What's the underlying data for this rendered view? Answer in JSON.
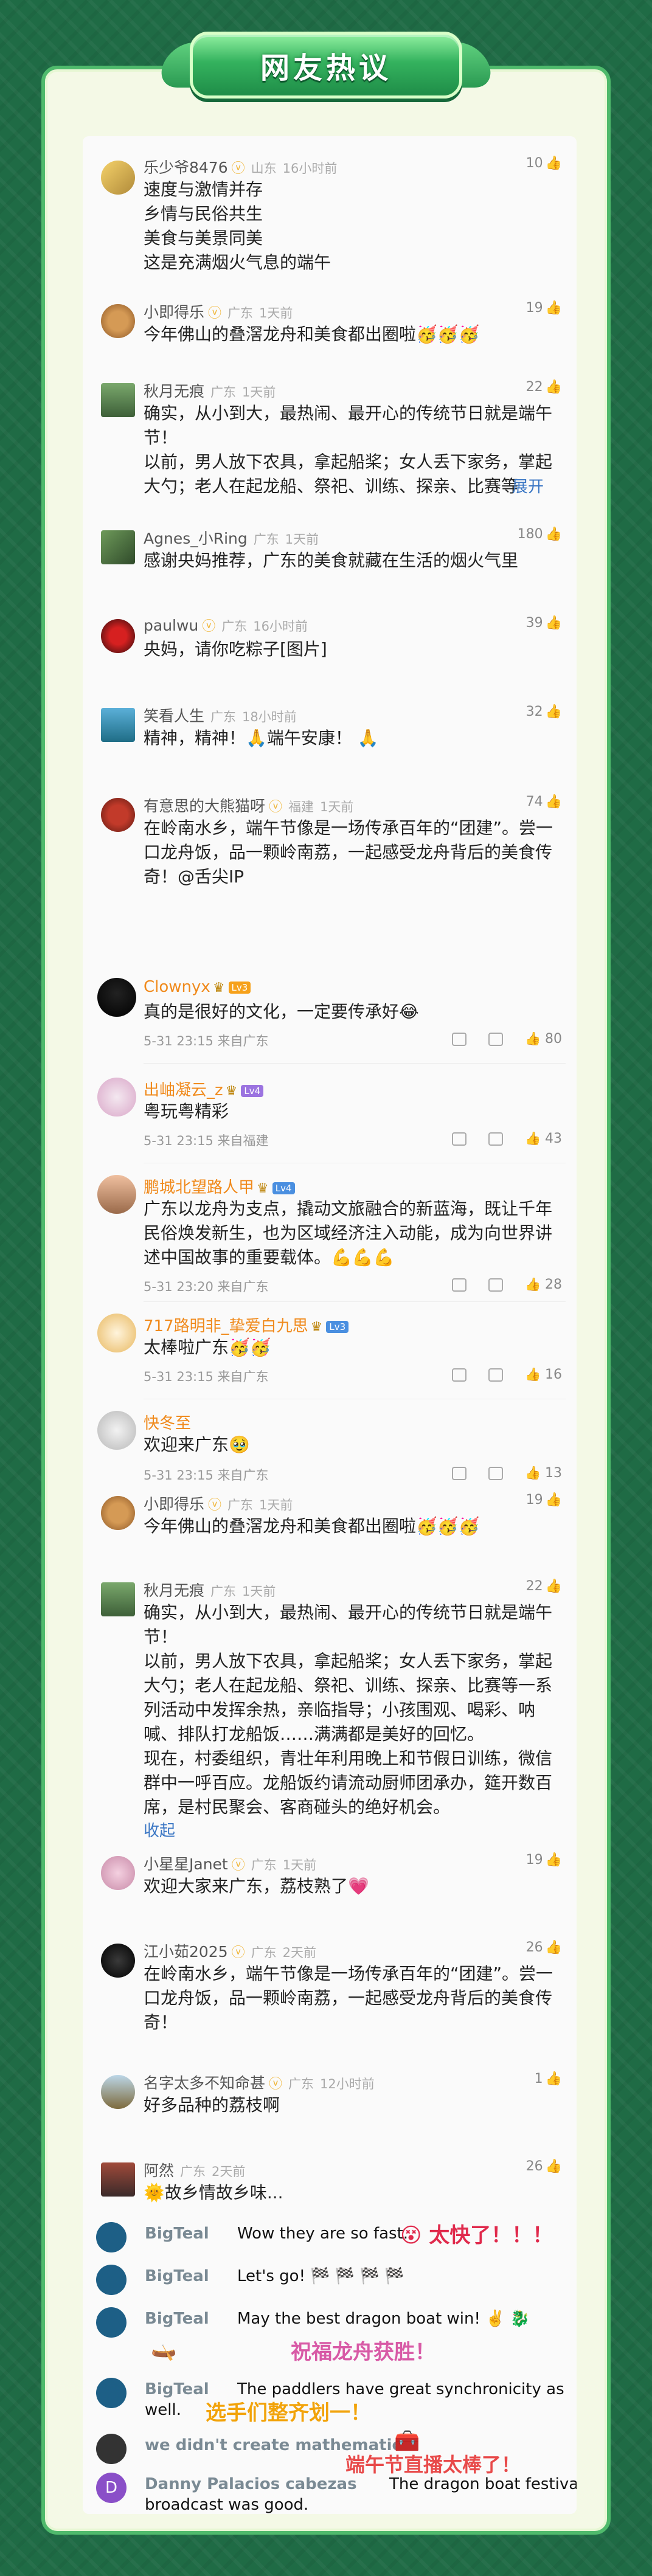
{
  "banner": {
    "title": "网友热议"
  },
  "icons": {
    "like": "thumbs-up-icon",
    "share": "share-icon",
    "reply": "comment-icon",
    "verified": "v-badge-icon"
  },
  "comments": [
    {
      "user": "乐少爷8476",
      "location": "山东",
      "time": "16小时前",
      "likes": "10",
      "lines": [
        "速度与激情并存",
        "乡情与民俗共生",
        "美食与美景同美",
        "这是充满烟火气息的端午"
      ]
    },
    {
      "user": "小即得乐",
      "location": "广东",
      "time": "1天前",
      "likes": "19",
      "lines": [
        "今年佛山的叠滘龙舟和美食都出圈啦🥳🥳🥳"
      ]
    },
    {
      "user": "秋月无痕",
      "location": "广东",
      "time": "1天前",
      "likes": "22",
      "lines": [
        "确实，从小到大，最热闹、最开心的传统节日就是端午",
        "节！",
        "以前，男人放下农具，拿起船桨；女人丢下家务，掌起",
        "大勺；老人在起龙船、祭祀、训练、探亲、比赛等"
      ],
      "expand": "展开"
    },
    {
      "user": "Agnes_小Ring",
      "location": "广东",
      "time": "1天前",
      "likes": "180",
      "lines": [
        "感谢央妈推荐，广东的美食就藏在生活的烟火气里"
      ]
    },
    {
      "user": "paulwu",
      "location": "广东",
      "time": "16小时前",
      "likes": "39",
      "lines": [
        "央妈，请你吃粽子[图片]"
      ]
    },
    {
      "user": "笑看人生",
      "location": "广东",
      "time": "18小时前",
      "likes": "32",
      "lines": [
        "精神，精神！🙏端午安康！ 🙏"
      ]
    },
    {
      "user": "有意思的大熊猫呀",
      "location": "福建",
      "time": "1天前",
      "likes": "74",
      "lines": [
        "在岭南水乡，端午节像是一场传承百年的“团建”。尝一",
        "口龙舟饭，品一颗岭南荔，一起感受龙舟背后的美食传",
        "奇！@舌尖IP"
      ]
    }
  ],
  "weibo": [
    {
      "user": "Clownyx",
      "level": "3",
      "text": "真的是很好的文化，一定要传承好😂",
      "date": "5-31 23:15 来自广东",
      "likes": "80"
    },
    {
      "user": "出岫凝云_z",
      "level": "4",
      "text": "粤玩粤精彩",
      "date": "5-31 23:15 来自福建",
      "likes": "43"
    },
    {
      "user": "鹏城北望路人甲",
      "level": "4",
      "lines": [
        "广东以龙舟为支点，撬动文旅融合的新蓝海，既让千年",
        "民俗焕发新生，也为区域经济注入动能，成为向世界讲",
        "述中国故事的重要载体。💪💪💪"
      ],
      "date": "5-31 23:20 来自广东",
      "likes": "28"
    },
    {
      "user": "717路明非_挚爱白九思",
      "level": "3",
      "text": "太棒啦广东🥳🥳",
      "date": "5-31 23:15 来自广东",
      "likes": "16"
    },
    {
      "user": "快冬至",
      "text": "欢迎来广东🥹",
      "date": "5-31 23:15 来自广东",
      "likes": "13"
    }
  ],
  "comments2": [
    {
      "user": "小即得乐",
      "location": "广东",
      "time": "1天前",
      "likes": "19",
      "lines": [
        "今年佛山的叠滘龙舟和美食都出圈啦🥳🥳🥳"
      ]
    },
    {
      "user": "秋月无痕",
      "location": "广东",
      "time": "1天前",
      "likes": "22",
      "lines": [
        "确实，从小到大，最热闹、最开心的传统节日就是端午",
        "节！",
        "以前，男人放下农具，拿起船桨；女人丢下家务，掌起",
        "大勺；老人在起龙船、祭祀、训练、探亲、比赛等一系",
        "列活动中发挥余热，亲临指导；小孩围观、喝彩、呐",
        "喊、排队打龙船饭……满满都是美好的回忆。",
        "现在，村委组织，青壮年利用晚上和节假日训练，微信",
        "群中一呼百应。龙船饭约请流动厨师团承办，筵开数百",
        "席，是村民聚会、客商碰头的绝好机会。"
      ],
      "collapse": "收起"
    },
    {
      "user": "小星星Janet",
      "location": "广东",
      "time": "1天前",
      "likes": "19",
      "lines": [
        "欢迎大家来广东，荔枝熟了💗"
      ]
    },
    {
      "user": "江小茹2025",
      "location": "广东",
      "time": "2天前",
      "likes": "26",
      "lines": [
        "在岭南水乡，端午节像是一场传承百年的“团建”。尝一",
        "口龙舟饭，品一颗岭南荔，一起感受龙舟背后的美食传",
        "奇！"
      ]
    },
    {
      "user": "名字太多不知命甚",
      "location": "广东",
      "time": "12小时前",
      "likes": "1",
      "lines": [
        "好多品种的荔枝啊"
      ]
    },
    {
      "user": "阿然",
      "location": "广东",
      "time": "2天前",
      "likes": "26",
      "lines": [
        "🌞故乡情故乡味..."
      ]
    }
  ],
  "chat": [
    {
      "user": "BigTeal",
      "msg": "Wow they are so fast.",
      "sticker": "太快了！！！"
    },
    {
      "user": "BigTeal",
      "msg": "Let's go! 🏁 🏁 🏁 🏁"
    },
    {
      "user": "BigTeal",
      "msg": "May the best dragon boat win! ✌️ 🐉",
      "sticker": "祝福龙舟获胜！"
    },
    {
      "user": "BigTeal",
      "msg_lines": [
        "The paddlers have great synchronicity as",
        "well."
      ],
      "sticker": "选手们整齐划一！"
    },
    {
      "user": "we didn't create mathematics",
      "sticker": "端午节直播太棒了！"
    },
    {
      "user": "Danny Palacios cabezas",
      "msg_lines": [
        "The dragon boat festival",
        "broadcast was good."
      ],
      "avatar_letter": "D"
    }
  ]
}
